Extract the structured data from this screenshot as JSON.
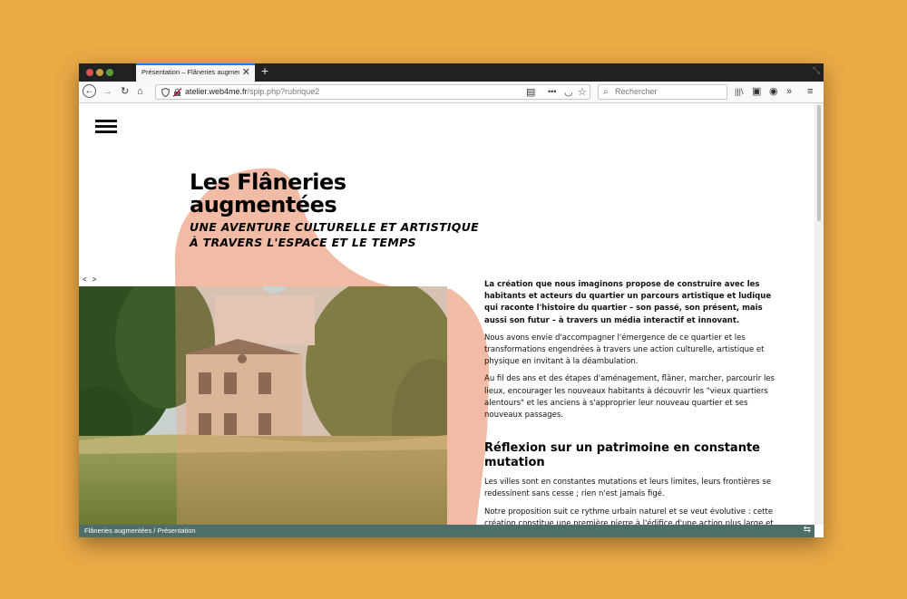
{
  "browser": {
    "tab_title": "Présentation – Flâneries augmentées",
    "tab_close": "✕",
    "new_tab": "+",
    "url_domain": "atelier.web4me.fr",
    "url_path": "/spip.php?rubrique2",
    "search_placeholder": "Rechercher",
    "icons": {
      "back": "←",
      "forward": "→",
      "reload": "↻",
      "home": "⌂",
      "reader": "▤",
      "more": "•••",
      "pocket": "◡",
      "bookmark": "☆",
      "search": "⌕",
      "library": "|||\\",
      "sidebar": "▣",
      "account": "◉",
      "overflow": "»",
      "menu": "≡",
      "corner": "⤡"
    }
  },
  "page": {
    "title": "Les Flâneries augmentées",
    "subtitle_line1": "Une aventure culturelle et artistique",
    "subtitle_line2": "à travers l'espace et le temps",
    "carousel_prev": "<",
    "carousel_next": ">",
    "lead": "La création que nous imaginons propose de construire avec les habitants et acteurs du quartier un parcours artistique et ludique qui raconte l'histoire du quartier – son passé, son présent, mais aussi son futur – à travers un média interactif et innovant.",
    "para1": "Nous avons envie d'accompagner l'émergence de ce quartier et les transformations engendrées à travers une action culturelle, artistique et physique en invitant à la déambulation.",
    "para2": "Au fil des ans et des étapes d'aménagement, flâner, marcher, parcourir les lieux, encourager les nouveaux habitants à découvrir les \"vieux quartiers alentours\" et les anciens à s'approprier leur nouveau quartier et ses nouveaux passages.",
    "section_title": "Réflexion sur un patrimoine en constante mutation",
    "section_p1": "Les villes sont en constantes mutations et leurs limites, leurs frontières se redessinent sans cesse ; rien n'est jamais figé.",
    "section_p2": "Notre proposition suit ce rythme urbain naturel et se veut évolutive : cette création constitue une première pierre à l'édifice d'une action plus large et"
  },
  "footer": {
    "breadcrumb": "Flâneries augmentées / Présentation",
    "icon": "⇆"
  },
  "colors": {
    "background": "#ecaa46",
    "accent_shape": "#f2bba5",
    "footer": "#4e6e6a"
  }
}
